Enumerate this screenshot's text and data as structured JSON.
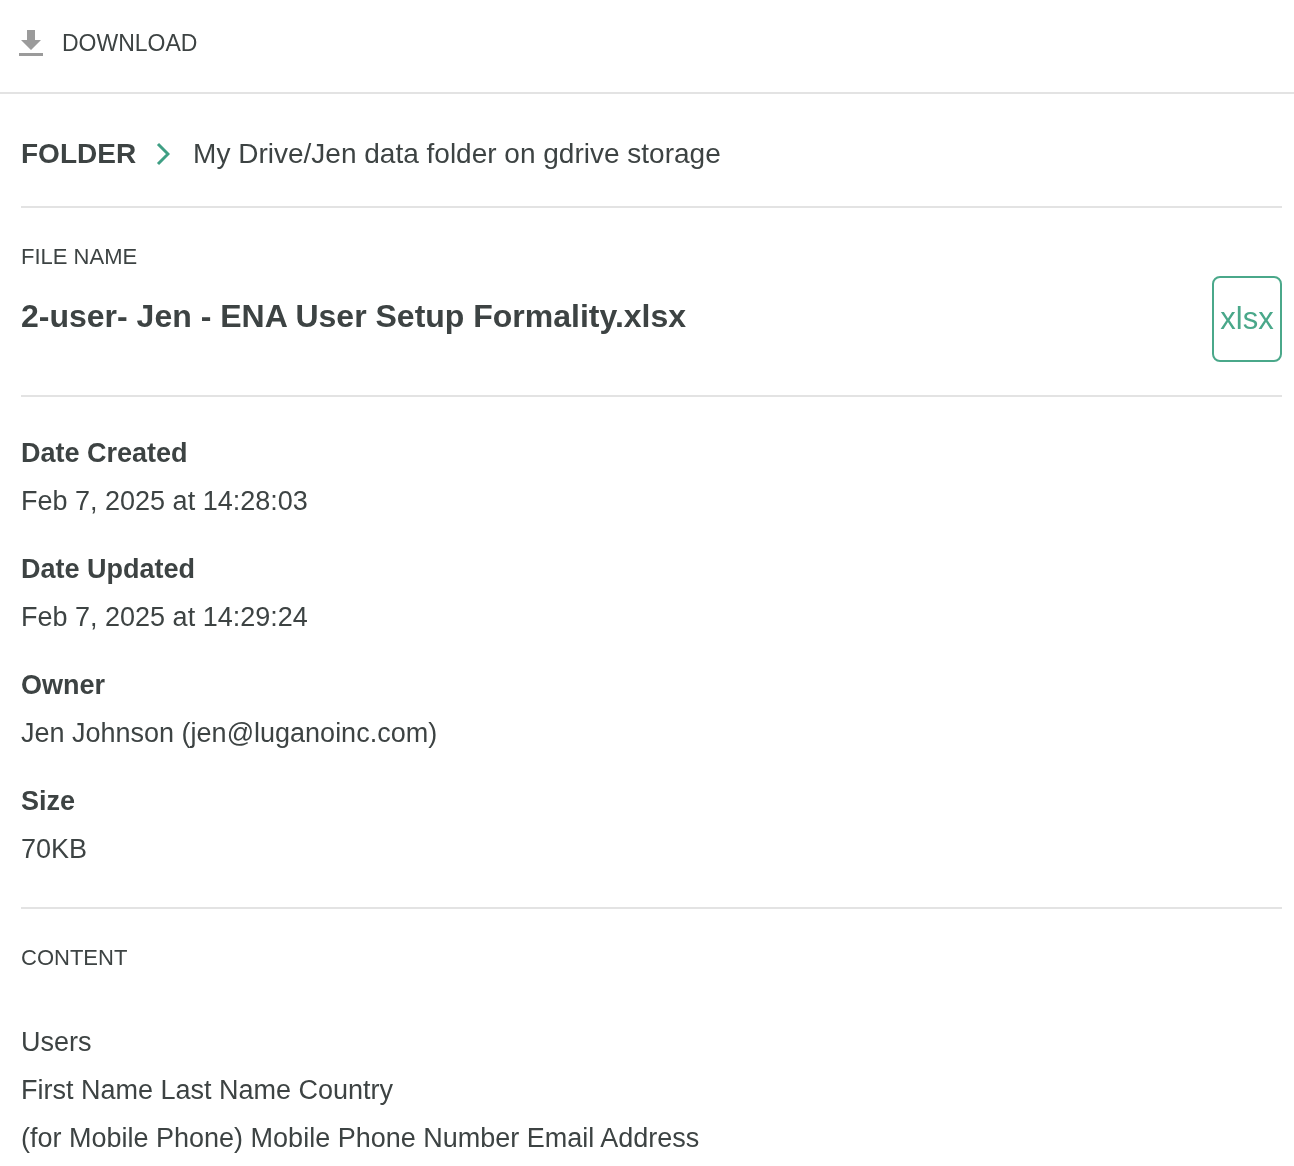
{
  "toolbar": {
    "download_label": "DOWNLOAD"
  },
  "folder": {
    "label": "FOLDER",
    "path": "My Drive/Jen data folder on gdrive storage"
  },
  "file": {
    "label": "FILE NAME",
    "name": "2-user- Jen - ENA User Setup Formality.xlsx",
    "type_badge": "xlsx"
  },
  "details": [
    {
      "label": "Date Created",
      "value": "Feb 7, 2025 at 14:28:03"
    },
    {
      "label": "Date Updated",
      "value": "Feb 7, 2025 at 14:29:24"
    },
    {
      "label": "Owner",
      "value": "Jen Johnson (jen@luganoinc.com)"
    },
    {
      "label": "Size",
      "value": "70KB"
    }
  ],
  "content": {
    "label": "CONTENT",
    "lines": [
      "Users",
      "First Name Last Name Country",
      "(for Mobile Phone) Mobile Phone Number Email Address"
    ]
  }
}
